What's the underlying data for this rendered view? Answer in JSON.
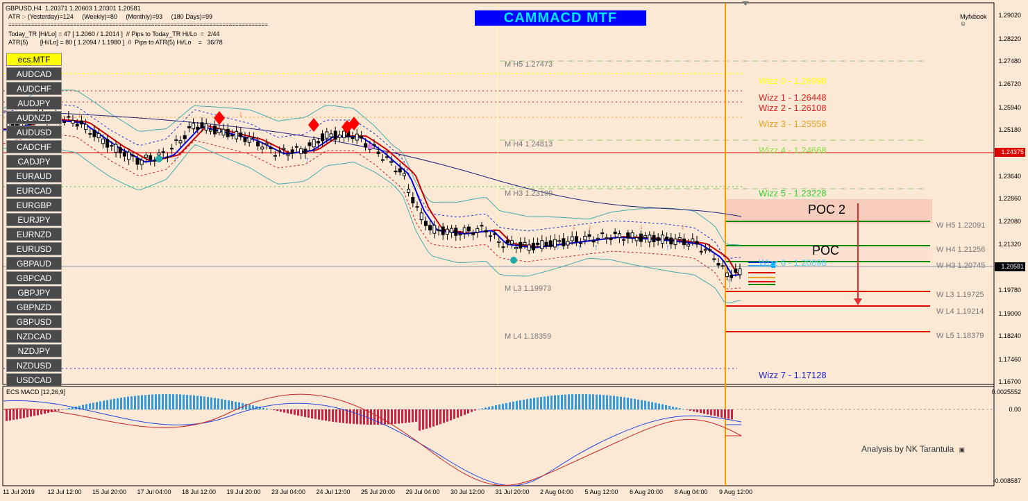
{
  "header": {
    "symbol_line": "GBPUSD,H4  1.20371 1.20603 1.20301 1.20581",
    "atr_line": "ATR :- (Yesterday)=124     (Weekly)=80     (Monthly)=93     (180 Days)=99",
    "separator": "================================================================================",
    "today_tr": "Today_TR [Hi/Lo] = 47 [ 1.2060 / 1.2014 ]  // Pips to Today_TR Hi/Lo  =  2/44",
    "atr5": "ATR(5)       [Hi/Lo] = 80 [ 1.2094 / 1.1980 ]  //  Pips to ATR(5) Hi/Lo    =   36/78",
    "badge": "CAMMACD MTF",
    "brand": "Myfxbook"
  },
  "symbols": [
    "ecs.MTF",
    "AUDCAD",
    "AUDCHF",
    "AUDJPY",
    "AUDNZD",
    "AUDUSD",
    "CADCHF",
    "CADJPY",
    "EURAUD",
    "EURCAD",
    "EURGBP",
    "EURJPY",
    "EURNZD",
    "EURUSD",
    "GBPAUD",
    "GBPCAD",
    "GBPJPY",
    "GBPNZD",
    "GBPUSD",
    "NZDCAD",
    "NZDJPY",
    "NZDUSD",
    "USDCAD"
  ],
  "levels": {
    "wizz": [
      "Wizz 0 - 1.26998",
      "Wizz 1 - 1.26448",
      "Wizz 2 - 1.26108",
      "Wizz 3 - 1.25558",
      "Wizz 4 - 1.24668",
      "Wizz 5 - 1.23228",
      "Wizz 6 - 1.20898",
      "Wizz 7 - 1.17128"
    ],
    "monthly": [
      "M  H5 1.27473",
      "M  H4 1.24813",
      "M  H3 1.23199",
      "M  L3 1.19973",
      "M  L4 1.18359"
    ],
    "weekly": [
      "W  H5 1.22091",
      "W  H4 1.21256",
      "W  H3 1.20745",
      "W  L3 1.19725",
      "W  L4 1.19214",
      "W  L5 1.18379"
    ],
    "poc": "POC",
    "poc2": "POC 2"
  },
  "price_axis": [
    "1.29020",
    "1.28220",
    "1.27480",
    "1.26720",
    "1.25940",
    "1.25180",
    "1.24375",
    "1.23640",
    "1.22860",
    "1.22080",
    "1.21320",
    "1.20581",
    "1.19780",
    "1.19000",
    "1.18240",
    "1.17460",
    "1.16700"
  ],
  "current_price_label": "1.20581",
  "red_line_label": "1.24375",
  "time_axis": [
    "11 Jul 2019",
    "12 Jul 12:00",
    "15 Jul 20:00",
    "17 Jul 04:00",
    "18 Jul 12:00",
    "19 Jul 20:00",
    "23 Jul 04:00",
    "24 Jul 12:00",
    "25 Jul 20:00",
    "29 Jul 04:00",
    "30 Jul 12:00",
    "31 Jul 20:00",
    "2 Aug 04:00",
    "5 Aug 12:00",
    "6 Aug 20:00",
    "8 Aug 04:00",
    "9 Aug 12:00"
  ],
  "indicator": {
    "title": "ECS MACD [12,26,9]",
    "axis": [
      "0.0025552",
      "0.00",
      "-0.008587"
    ],
    "credit": "Analysis by NK Tarantula"
  },
  "colors": {
    "background": "#fbe9d6",
    "wizz": [
      "#ffff00",
      "#dd2222",
      "#dd2222",
      "#e8a020",
      "#88dd44",
      "#33cc33",
      "#55ccff",
      "#2222cc"
    ],
    "level_grey": "#777777",
    "vertical_marker": "#ff9900"
  }
}
